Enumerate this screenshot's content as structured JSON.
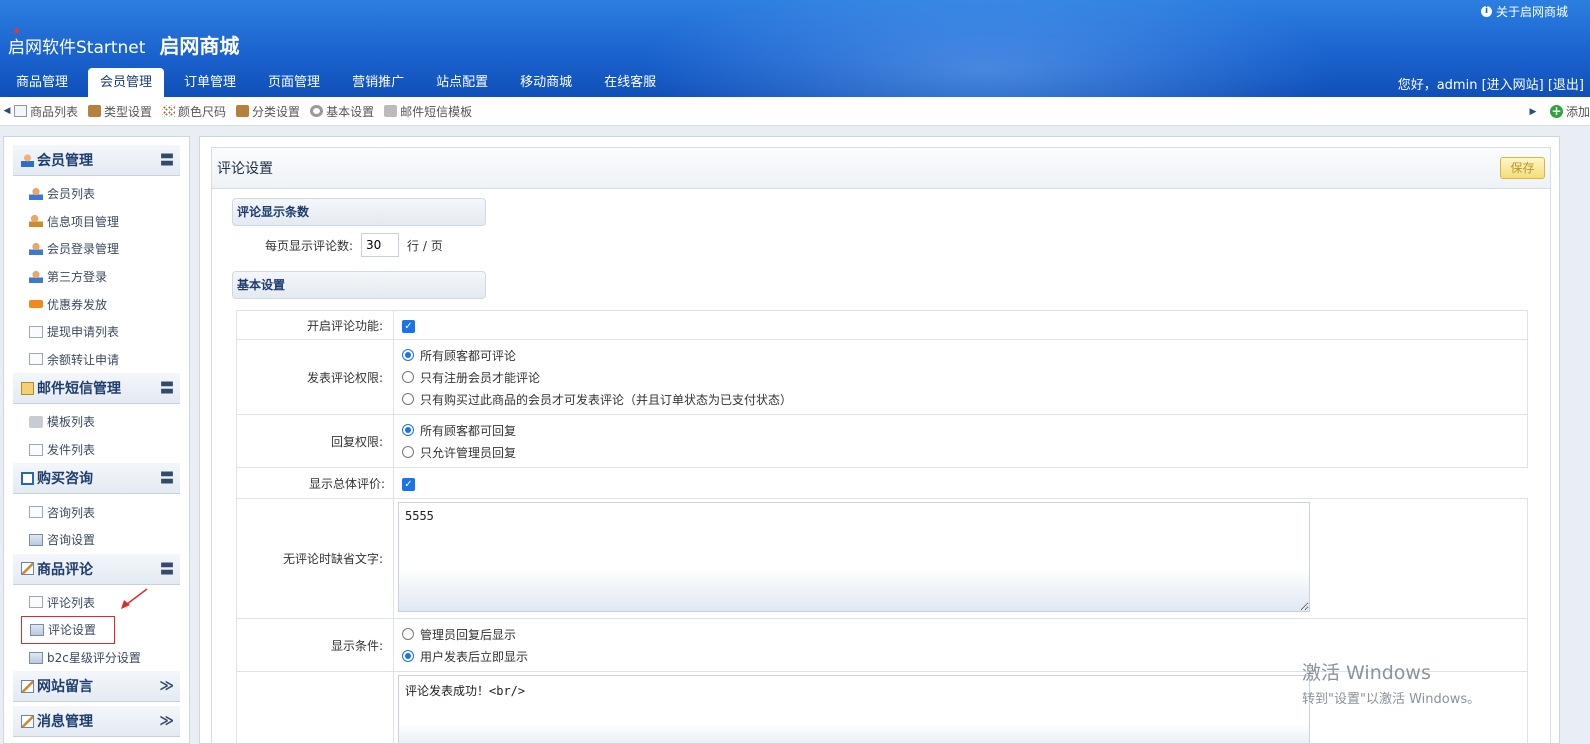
{
  "header": {
    "brand": "启网软件Startnet",
    "shop": "启网商城",
    "about": "关于启网商城",
    "tabs": [
      "商品管理",
      "会员管理",
      "订单管理",
      "页面管理",
      "营销推广",
      "站点配置",
      "移动商城",
      "在线客服"
    ],
    "active_tab": "会员管理",
    "user_text": "您好，admin [进入网站] [退出]",
    "colors": {
      "header_blue": "#1b63cf",
      "accent": "#1a73e8"
    }
  },
  "toolbar": {
    "items": [
      {
        "label": "商品列表",
        "icon": "document-icon"
      },
      {
        "label": "类型设置",
        "icon": "box-icon"
      },
      {
        "label": "颜色尺码",
        "icon": "dots-icon"
      },
      {
        "label": "分类设置",
        "icon": "box-icon"
      },
      {
        "label": "基本设置",
        "icon": "gear-icon"
      },
      {
        "label": "邮件短信模板",
        "icon": "cube-icon"
      }
    ],
    "add_label": "添加"
  },
  "sidebar": {
    "groups": [
      {
        "title": "会员管理",
        "toggle": "〓",
        "items": [
          "会员列表",
          "信息项目管理",
          "会员登录管理",
          "第三方登录",
          "优惠券发放",
          "提现申请列表",
          "余额转让申请"
        ]
      },
      {
        "title": "邮件短信管理",
        "toggle": "〓",
        "items": [
          "模板列表",
          "发件列表"
        ]
      },
      {
        "title": "购买咨询",
        "toggle": "〓",
        "items": [
          "咨询列表",
          "咨询设置"
        ]
      },
      {
        "title": "商品评论",
        "toggle": "〓",
        "items": [
          "评论列表",
          "评论设置",
          "b2c星级评分设置"
        ]
      },
      {
        "title": "网站留言",
        "toggle": "≫"
      },
      {
        "title": "消息管理",
        "toggle": "≫"
      }
    ],
    "selected_item": "评论设置"
  },
  "main": {
    "title": "评论设置",
    "save_label": "保存",
    "section1": "评论显示条数",
    "perpage_label": "每页显示评论数:",
    "perpage_value": "30",
    "perpage_unit": "行 / 页",
    "section2": "基本设置",
    "rows": {
      "enable_label": "开启评论功能:",
      "perm_label": "发表评论权限:",
      "perm_options": [
        "所有顾客都可评论",
        "只有注册会员才能评论",
        "只有购买过此商品的会员才可发表评论（并且订单状态为已支付状态）"
      ],
      "reply_label": "回复权限:",
      "reply_options": [
        "所有顾客都可回复",
        "只允许管理员回复"
      ],
      "show_total_label": "显示总体评价:",
      "default_text_label": "无评论时缺省文字:",
      "default_text_value": "5555",
      "show_cond_label": "显示条件:",
      "show_cond_options": [
        "管理员回复后显示",
        "用户发表后立即显示"
      ],
      "success_text_value": "评论发表成功！<br/>"
    }
  },
  "watermark": {
    "line1": "激活 Windows",
    "line2": "转到\"设置\"以激活 Windows。"
  }
}
